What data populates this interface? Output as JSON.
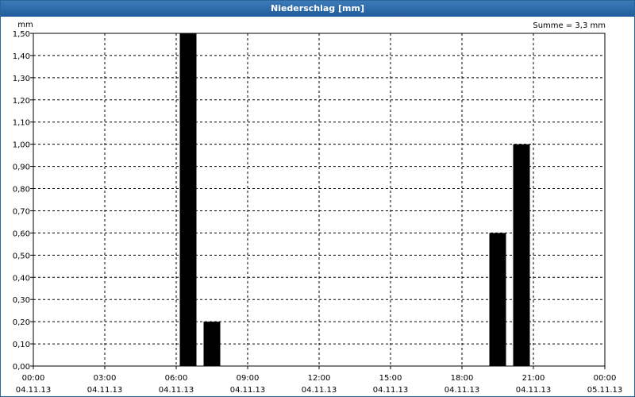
{
  "window": {
    "title": "Niederschlag [mm]",
    "sum_label": "Summe = 3,3 mm"
  },
  "colors": {
    "titlebar": "#1f5c99",
    "bar": "#000000",
    "grid": "#000000"
  },
  "chart_data": {
    "type": "bar",
    "title": "Niederschlag [mm]",
    "ylabel": "mm",
    "xlabel": "",
    "ylim": [
      0,
      1.5
    ],
    "y_ticks": [
      "0,00",
      "0,10",
      "0,20",
      "0,30",
      "0,40",
      "0,50",
      "0,60",
      "0,70",
      "0,80",
      "0,90",
      "1,00",
      "1,10",
      "1,20",
      "1,30",
      "1,40",
      "1,50"
    ],
    "x_range_hours": [
      0,
      24
    ],
    "x_ticks": [
      {
        "time": "00:00",
        "date": "04.11.13"
      },
      {
        "time": "03:00",
        "date": "04.11.13"
      },
      {
        "time": "06:00",
        "date": "04.11.13"
      },
      {
        "time": "09:00",
        "date": "04.11.13"
      },
      {
        "time": "12:00",
        "date": "04.11.13"
      },
      {
        "time": "15:00",
        "date": "04.11.13"
      },
      {
        "time": "18:00",
        "date": "04.11.13"
      },
      {
        "time": "21:00",
        "date": "04.11.13"
      },
      {
        "time": "00:00",
        "date": "05.11.13"
      }
    ],
    "bars": [
      {
        "start": "06:00",
        "end": "07:00",
        "value": 1.5
      },
      {
        "start": "07:00",
        "end": "08:00",
        "value": 0.2
      },
      {
        "start": "19:00",
        "end": "20:00",
        "value": 0.6
      },
      {
        "start": "20:00",
        "end": "21:00",
        "value": 1.0
      }
    ],
    "grid": true,
    "legend": "none"
  }
}
